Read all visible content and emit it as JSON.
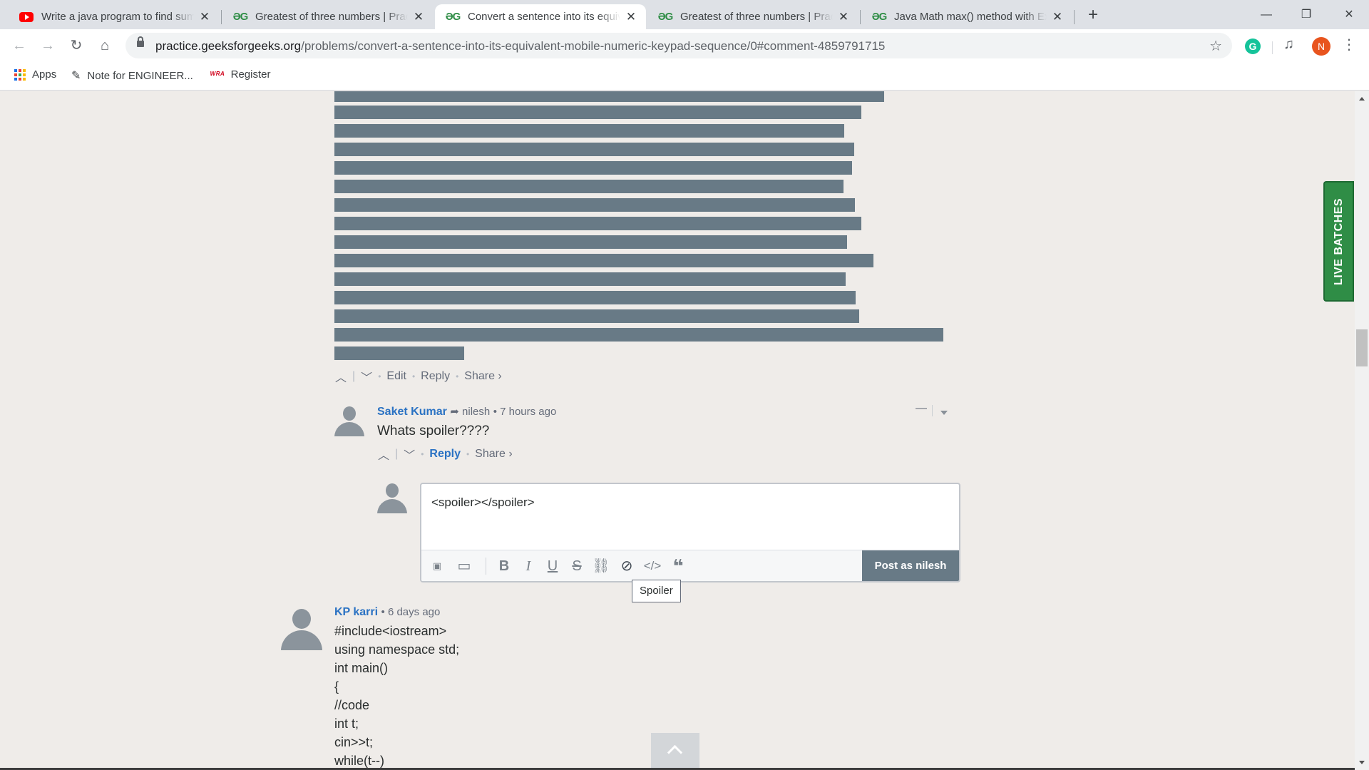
{
  "tabs": [
    {
      "title": "Write a java program to find sum",
      "favicon": "youtube-icon"
    },
    {
      "title": "Greatest of three numbers | Practice",
      "favicon": "gfg-icon"
    },
    {
      "title": "Convert a sentence into its equivalent",
      "favicon": "gfg-icon",
      "active": true
    },
    {
      "title": "Greatest of three numbers | Practice",
      "favicon": "gfg-icon"
    },
    {
      "title": "Java Math max() method with Examples",
      "favicon": "gfg-icon"
    }
  ],
  "tab_close": "✕",
  "new_tab": "+",
  "window": {
    "minimize": "—",
    "restore": "❐",
    "close": "✕"
  },
  "address": {
    "host": "practice.geeksforgeeks.org",
    "path": "/problems/convert-a-sentence-into-its-equivalent-mobile-numeric-keypad-sequence/0#comment-4859791715"
  },
  "toolbar_icons": {
    "grammarly": "G",
    "profile": "N"
  },
  "bookmarks": [
    {
      "label": "Apps",
      "icon": "apps-grid-icon"
    },
    {
      "label": "Note for ENGINEER...",
      "icon": "note-icon"
    },
    {
      "label": "Register",
      "icon": "register-icon"
    }
  ],
  "first_comment_actions": {
    "edit": "Edit",
    "reply": "Reply",
    "share": "Share ›"
  },
  "saket_comment": {
    "author": "Saket Kumar",
    "reply_to": "nilesh",
    "time": "7 hours ago",
    "text": "Whats spoiler????",
    "reply": "Reply",
    "share": "Share ›"
  },
  "reply_box": {
    "text": "<spoiler></spoiler>",
    "post_label": "Post as nilesh",
    "tooltip": "Spoiler"
  },
  "kp_comment": {
    "author": "KP karri",
    "time": "6 days ago",
    "code_lines": [
      "#include<iostream>",
      "using namespace std;",
      "int main()",
      "{",
      "//code",
      "int t;",
      "cin>>t;",
      "while(t--)"
    ]
  },
  "live_batches": "LIVE  BATCHES"
}
